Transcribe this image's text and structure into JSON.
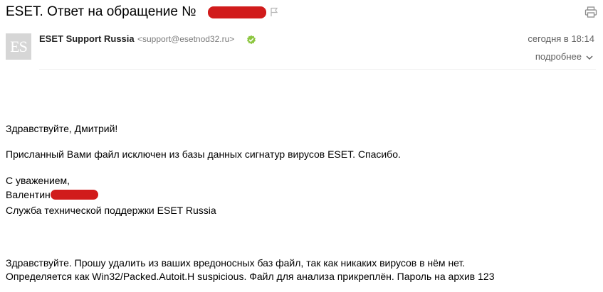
{
  "email": {
    "subject": "ESET. Ответ на обращение №",
    "sender_name": "ESET Support Russia",
    "sender_email": "<support@esetnod32.ru>",
    "avatar_initials": "ES",
    "date": "сегодня в 18:14",
    "details_link": "подробнее",
    "body": {
      "greeting": "Здравствуйте, Дмитрий!",
      "message": "Присланный Вами файл исключен из базы данных сигнатур вирусов ESET. Спасибо.",
      "closing": "С уважением,",
      "signature_name": "Валентин",
      "signature_org": "Служба технической поддержки ESET Russia",
      "quoted_line1": "Здравствуйте. Прошу удалить из ваших вредоносных баз файл, так как никаких вирусов в нём нет.",
      "quoted_line2": "Определяется как Win32/Packed.Autoit.H suspicious. Файл для анализа прикреплён. Пароль на архив 123"
    }
  },
  "colors": {
    "redaction": "#d11b1b",
    "verified_badge": "#8cc63f",
    "muted_text": "#7a7a7a"
  },
  "icons": {
    "flag": "flag-icon",
    "print": "print-icon",
    "verified": "verified-badge-icon",
    "chevron": "chevron-down-icon"
  }
}
